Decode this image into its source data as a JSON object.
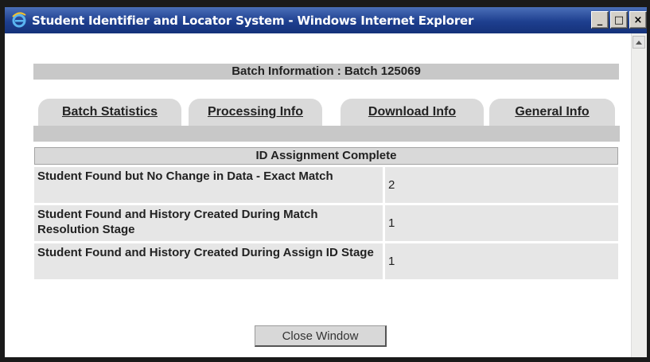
{
  "window": {
    "title": "Student Identifier and Locator System - Windows Internet Explorer",
    "minimize_glyph": "_",
    "maximize_glyph": "□",
    "close_glyph": "×"
  },
  "batch": {
    "header": "Batch Information : Batch 125069"
  },
  "tabs": [
    {
      "label": "Batch Statistics",
      "active": true
    },
    {
      "label": "Processing Info",
      "active": false
    },
    {
      "label": "Download Info",
      "active": false
    },
    {
      "label": "General Info",
      "active": false
    }
  ],
  "stats": {
    "heading": "ID Assignment Complete",
    "rows": [
      {
        "label": "Student Found but No Change in Data - Exact Match",
        "value": "2"
      },
      {
        "label": "Student Found and History Created During Match Resolution Stage",
        "value": "1"
      },
      {
        "label": "Student Found and History Created During Assign ID Stage",
        "value": "1"
      }
    ]
  },
  "buttons": {
    "close_window": "Close Window"
  },
  "colors": {
    "titlebar": "#1e3f8f",
    "header_bg": "#c8c8c8",
    "tab_bg": "#dadada",
    "row_bg": "#e6e6e6"
  },
  "icons": {
    "app_icon": "internet-explorer-icon",
    "scroll_up": "scroll-up-arrow-icon"
  }
}
